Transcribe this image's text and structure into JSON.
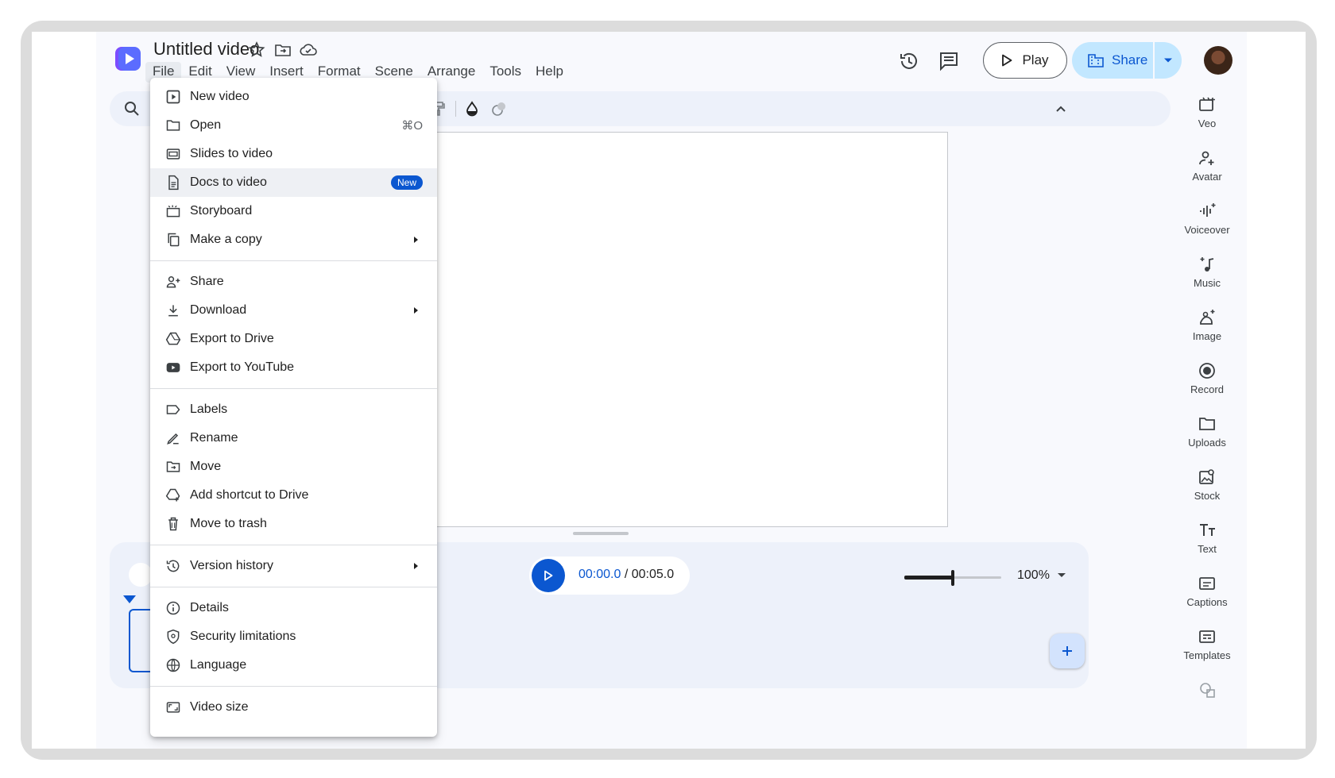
{
  "doc": {
    "title": "Untitled video"
  },
  "menubar": [
    "File",
    "Edit",
    "View",
    "Insert",
    "Format",
    "Scene",
    "Arrange",
    "Tools",
    "Help"
  ],
  "header": {
    "play_label": "Play",
    "share_label": "Share"
  },
  "playback": {
    "current": "00:00.0",
    "separator": " / ",
    "total": "00:05.0"
  },
  "zoom": {
    "label": "100%",
    "level": 0.5
  },
  "file_menu": {
    "groups": [
      [
        {
          "label": "New video",
          "icon": "video-file-icon"
        },
        {
          "label": "Open",
          "icon": "folder-icon",
          "shortcut": "⌘O"
        },
        {
          "label": "Slides to video",
          "icon": "slides-icon"
        },
        {
          "label": "Docs to video",
          "icon": "doc-icon",
          "badge": "New"
        },
        {
          "label": "Storyboard",
          "icon": "storyboard-icon"
        },
        {
          "label": "Make a copy",
          "icon": "copy-icon",
          "submenu": true
        }
      ],
      [
        {
          "label": "Share",
          "icon": "share-person-icon"
        },
        {
          "label": "Download",
          "icon": "download-icon",
          "submenu": true
        },
        {
          "label": "Export to Drive",
          "icon": "drive-icon"
        },
        {
          "label": "Export to YouTube",
          "icon": "youtube-icon"
        }
      ],
      [
        {
          "label": "Labels",
          "icon": "label-icon"
        },
        {
          "label": "Rename",
          "icon": "rename-icon"
        },
        {
          "label": "Move",
          "icon": "move-folder-icon"
        },
        {
          "label": "Add shortcut to Drive",
          "icon": "drive-shortcut-icon"
        },
        {
          "label": "Move to trash",
          "icon": "trash-icon"
        }
      ],
      [
        {
          "label": "Version history",
          "icon": "history-icon",
          "submenu": true
        }
      ],
      [
        {
          "label": "Details",
          "icon": "info-icon"
        },
        {
          "label": "Security limitations",
          "icon": "shield-icon"
        },
        {
          "label": "Language",
          "icon": "globe-icon"
        }
      ],
      [
        {
          "label": "Video size",
          "icon": "aspect-ratio-icon"
        }
      ]
    ],
    "highlighted": "Docs to video"
  },
  "rail": [
    {
      "label": "Veo",
      "icon": "veo-icon"
    },
    {
      "label": "Avatar",
      "icon": "avatar-add-icon"
    },
    {
      "label": "Voiceover",
      "icon": "voiceover-icon"
    },
    {
      "label": "Music",
      "icon": "music-icon"
    },
    {
      "label": "Image",
      "icon": "image-spark-icon"
    },
    {
      "label": "Record",
      "icon": "record-icon"
    },
    {
      "label": "Uploads",
      "icon": "folder-icon"
    },
    {
      "label": "Stock",
      "icon": "stock-image-icon"
    },
    {
      "label": "Text",
      "icon": "text-icon"
    },
    {
      "label": "Captions",
      "icon": "captions-icon"
    },
    {
      "label": "Templates",
      "icon": "templates-icon"
    }
  ],
  "colors": {
    "accent": "#0b57d0",
    "share_bg": "#c2e7ff",
    "toolbar_bg": "#edf1fa"
  }
}
